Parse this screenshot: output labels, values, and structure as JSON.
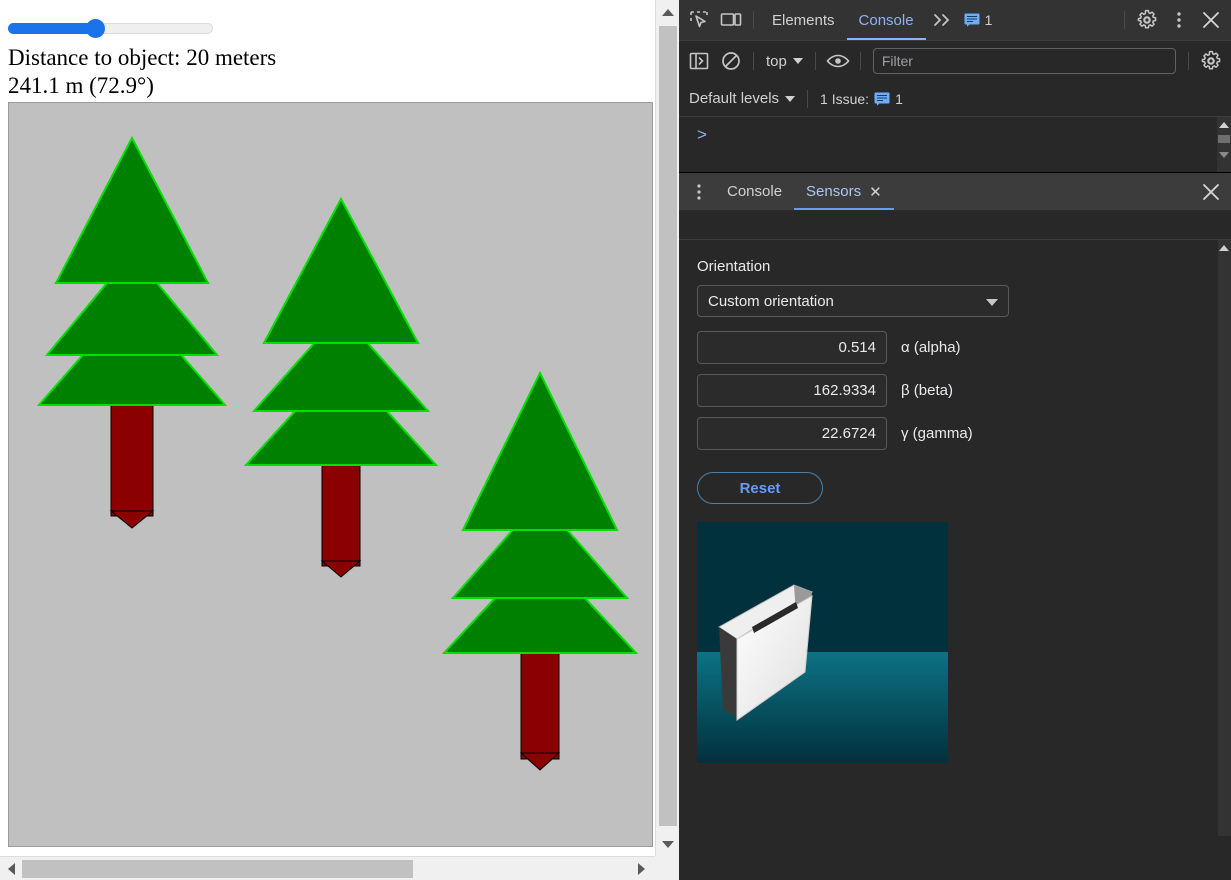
{
  "page": {
    "slider": {
      "name": "distance-slider",
      "value": 20,
      "min": 0,
      "max": 50
    },
    "distance_label": "Distance to object: 20 meters",
    "reading_label": "241.1 m (72.9°)",
    "canvas": {
      "background_color": "#c0c0c0",
      "tree_fill": "#008000",
      "tree_stroke": "#00dd00",
      "trunk_fill": "#8b0000",
      "trunk_stroke": "#000000"
    }
  },
  "devtools": {
    "main_toolbar": {
      "inspect_icon": "inspect-element-icon",
      "device_icon": "device-toolbar-icon",
      "tabs": [
        {
          "label": "Elements",
          "active": false
        },
        {
          "label": "Console",
          "active": true
        }
      ],
      "more_tabs_icon": "chevron-double-right-icon",
      "issues_count": "1",
      "settings_icon": "gear-icon",
      "more_icon": "kebab-menu-icon",
      "close_icon": "close-icon"
    },
    "console_toolbar": {
      "sidebar_icon": "console-sidebar-icon",
      "clear_icon": "clear-console-icon",
      "context": "top",
      "eye_icon": "live-expression-icon",
      "filter_placeholder": "Filter",
      "filter_value": "",
      "settings_icon": "gear-icon"
    },
    "level_bar": {
      "levels_label": "Default levels",
      "issues_text": "1 Issue:",
      "issues_badge": "1",
      "issue_icon": "issue-message-icon",
      "badge_color": "#6badf7"
    },
    "console_prompt": ">",
    "drawer": {
      "menu_icon": "kebab-menu-icon",
      "tabs": [
        {
          "label": "Console",
          "active": false,
          "closable": false
        },
        {
          "label": "Sensors",
          "active": true,
          "closable": true
        }
      ],
      "close_icon": "close-icon"
    },
    "sensors": {
      "section_title": "Orientation",
      "orientation_select": "Custom orientation",
      "fields": [
        {
          "label": "α (alpha)",
          "value": "0.514"
        },
        {
          "label": "β (beta)",
          "value": "162.9334"
        },
        {
          "label": "γ (gamma)",
          "value": "22.6724"
        }
      ],
      "reset_label": "Reset",
      "preview": {
        "name": "device-orientation-preview",
        "sky_color": "#003340",
        "ground_color": "#0b6a7d",
        "device_color": "#f2f2f2"
      }
    }
  }
}
